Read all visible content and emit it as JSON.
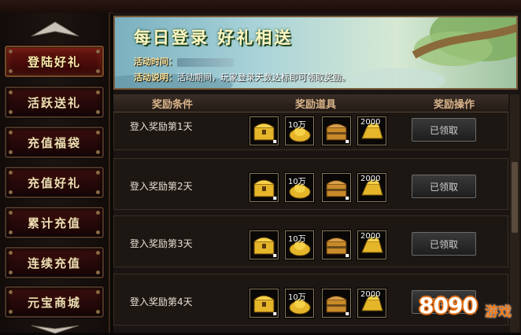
{
  "sidebar": {
    "items": [
      {
        "label": "登陆好礼",
        "active": true
      },
      {
        "label": "活跃送礼",
        "active": false
      },
      {
        "label": "充值福袋",
        "active": false
      },
      {
        "label": "充值好礼",
        "active": false
      },
      {
        "label": "累计充值",
        "active": false
      },
      {
        "label": "连续充值",
        "active": false
      },
      {
        "label": "元宝商城",
        "active": false
      }
    ]
  },
  "banner": {
    "title": "每日登录 好礼相送",
    "time_label": "活动时间：",
    "desc_label": "活动说明：",
    "desc_text": "活动期间，玩家登录天数达标即可领取奖励。"
  },
  "table": {
    "headers": [
      "奖励条件",
      "奖励道具",
      "奖励操作"
    ],
    "rows": [
      {
        "condition": "登入奖励第1天",
        "items": [
          {
            "icon": "golden-chest-icon",
            "qty": ""
          },
          {
            "icon": "gold-ingot-icon",
            "qty": "10万"
          },
          {
            "icon": "bronze-chest-icon",
            "qty": ""
          },
          {
            "icon": "gold-bar-icon",
            "qty": "2000"
          }
        ],
        "action": "已领取"
      },
      {
        "condition": "登入奖励第2天",
        "items": [
          {
            "icon": "golden-chest-icon",
            "qty": ""
          },
          {
            "icon": "gold-ingot-icon",
            "qty": "10万"
          },
          {
            "icon": "bronze-chest-icon",
            "qty": ""
          },
          {
            "icon": "gold-bar-icon",
            "qty": "2000"
          }
        ],
        "action": "已领取"
      },
      {
        "condition": "登入奖励第3天",
        "items": [
          {
            "icon": "golden-chest-icon",
            "qty": ""
          },
          {
            "icon": "gold-ingot-icon",
            "qty": "10万"
          },
          {
            "icon": "bronze-chest-icon",
            "qty": ""
          },
          {
            "icon": "gold-bar-icon",
            "qty": "2000"
          }
        ],
        "action": "已领取"
      },
      {
        "condition": "登入奖励第4天",
        "items": [
          {
            "icon": "golden-chest-icon",
            "qty": ""
          },
          {
            "icon": "gold-ingot-icon",
            "qty": "10万"
          },
          {
            "icon": "bronze-chest-icon",
            "qty": ""
          },
          {
            "icon": "gold-bar-icon",
            "qty": "2000"
          }
        ],
        "action": "已领取"
      }
    ]
  },
  "watermark": {
    "number": "8090",
    "text": "游戏"
  },
  "colors": {
    "accent_gold": "#d9b58a",
    "active_red": "#6b1611",
    "item_gold": "#e6b62a"
  }
}
